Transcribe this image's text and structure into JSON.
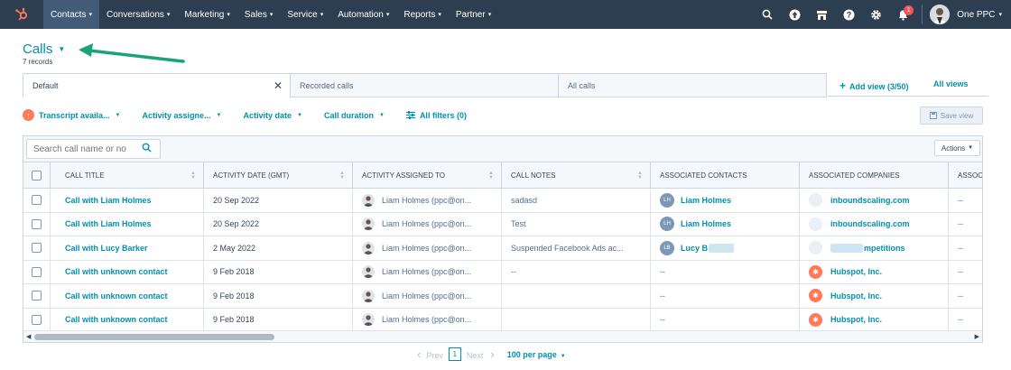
{
  "nav": {
    "items": [
      {
        "label": "Contacts"
      },
      {
        "label": "Conversations"
      },
      {
        "label": "Marketing"
      },
      {
        "label": "Sales"
      },
      {
        "label": "Service"
      },
      {
        "label": "Automation"
      },
      {
        "label": "Reports"
      },
      {
        "label": "Partner"
      }
    ],
    "notifications_count": "1",
    "account_name": "One PPC"
  },
  "header": {
    "title": "Calls",
    "records": "7 records"
  },
  "view_tabs": [
    {
      "label": "Default"
    },
    {
      "label": "Recorded calls"
    },
    {
      "label": "All calls"
    }
  ],
  "add_view_label": "Add view (3/50)",
  "all_views_label": "All views",
  "filters": {
    "transcript": "Transcript availa...",
    "assigned": "Activity assigne...",
    "activity_date": "Activity date",
    "call_duration": "Call duration",
    "all_filters": "All filters (0)",
    "save_view": "Save view"
  },
  "table": {
    "search_placeholder": "Search call name or no",
    "actions_label": "Actions",
    "columns": [
      "CALL TITLE",
      "ACTIVITY DATE (GMT)",
      "ACTIVITY ASSIGNED TO",
      "CALL NOTES",
      "ASSOCIATED CONTACTS",
      "ASSOCIATED COMPANIES",
      "ASSOC"
    ],
    "rows": [
      {
        "title": "Call with Liam Holmes",
        "date": "20 Sep 2022",
        "assigned": "Liam Holmes (ppc@on...",
        "notes": "sadasd",
        "contact_initials": "LH",
        "contact": "Liam Holmes",
        "company": "inboundscaling.com",
        "assoc": "--"
      },
      {
        "title": "Call with Liam Holmes",
        "date": "20 Sep 2022",
        "assigned": "Liam Holmes (ppc@on...",
        "notes": "Test",
        "contact_initials": "LH",
        "contact": "Liam Holmes",
        "company": "inboundscaling.com",
        "assoc": "--"
      },
      {
        "title": "Call with Lucy Barker",
        "date": "2 May 2022",
        "assigned": "Liam Holmes (ppc@on...",
        "notes": "Suspended Facebook Ads ac...",
        "contact_initials": "LB",
        "contact": "Lucy B",
        "company": "mpetitions",
        "assoc": "--"
      },
      {
        "title": "Call with unknown contact",
        "date": "9 Feb 2018",
        "assigned": "Liam Holmes (ppc@on...",
        "notes": "--",
        "contact_initials": "",
        "contact": "--",
        "company": "Hubspot, Inc.",
        "assoc": "--"
      },
      {
        "title": "Call with unknown contact",
        "date": "9 Feb 2018",
        "assigned": "Liam Holmes (ppc@on...",
        "notes": "",
        "contact_initials": "",
        "contact": "--",
        "company": "Hubspot, Inc.",
        "assoc": "--"
      },
      {
        "title": "Call with unknown contact",
        "date": "9 Feb 2018",
        "assigned": "Liam Holmes (ppc@on...",
        "notes": "",
        "contact_initials": "",
        "contact": "--",
        "company": "Hubspot, Inc.",
        "assoc": "--"
      }
    ]
  },
  "pagination": {
    "prev": "Prev",
    "page": "1",
    "next": "Next",
    "per_page": "100 per page"
  },
  "colors": {
    "nav_bg": "#2d3e50",
    "link": "#0091ae",
    "accent_orange": "#ff7a59",
    "annotation_arrow": "#1aa37a"
  }
}
